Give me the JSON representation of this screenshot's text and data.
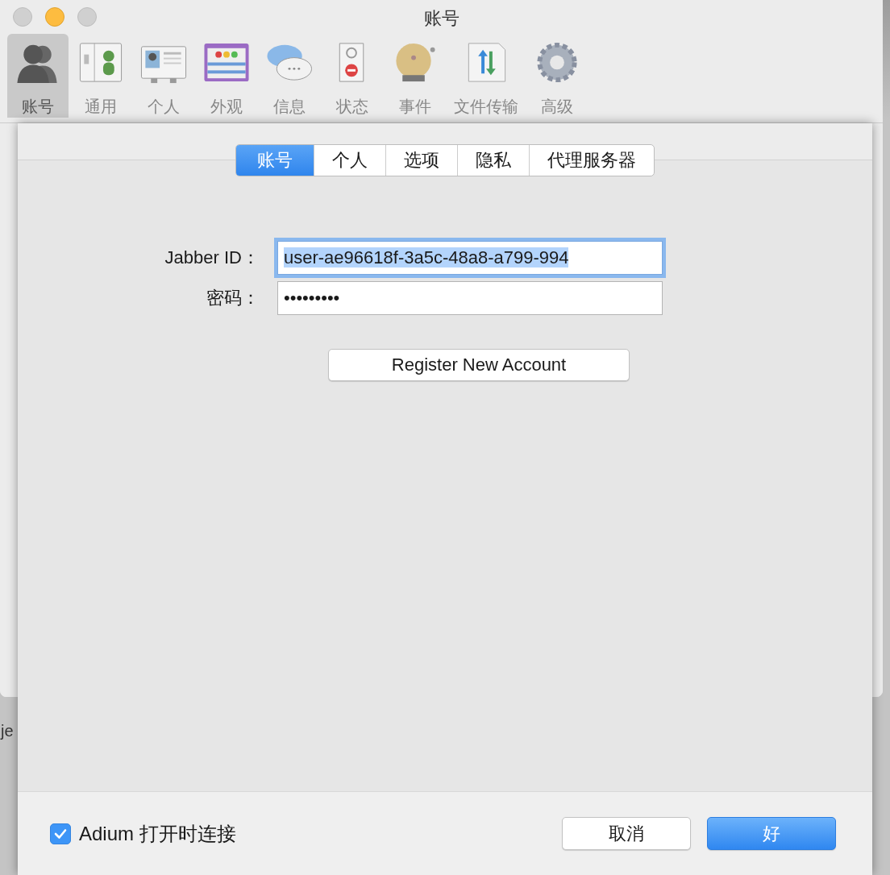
{
  "window": {
    "title": "账号"
  },
  "toolbar": {
    "items": [
      {
        "label": "账号",
        "selected": true
      },
      {
        "label": "通用",
        "selected": false
      },
      {
        "label": "个人",
        "selected": false
      },
      {
        "label": "外观",
        "selected": false
      },
      {
        "label": "信息",
        "selected": false
      },
      {
        "label": "状态",
        "selected": false
      },
      {
        "label": "事件",
        "selected": false
      },
      {
        "label": "文件传输",
        "selected": false
      },
      {
        "label": "高级",
        "selected": false
      }
    ]
  },
  "background_window": {
    "text": "je"
  },
  "sheet": {
    "tabs": [
      {
        "label": "账号",
        "selected": true
      },
      {
        "label": "个人",
        "selected": false
      },
      {
        "label": "选项",
        "selected": false
      },
      {
        "label": "隐私",
        "selected": false
      },
      {
        "label": "代理服务器",
        "selected": false
      }
    ],
    "jabber_id": {
      "label": "Jabber ID：",
      "value": "user-ae96618f-3a5c-48a8-a799-994",
      "focused": true
    },
    "password": {
      "label": "密码：",
      "value": "•••••••••",
      "focused": false
    },
    "register_button": "Register New Account",
    "connect_on_launch": {
      "label": "Adium 打开时连接",
      "checked": true
    },
    "buttons": [
      {
        "label": "取消",
        "primary": false
      },
      {
        "label": "好",
        "primary": true
      }
    ]
  }
}
